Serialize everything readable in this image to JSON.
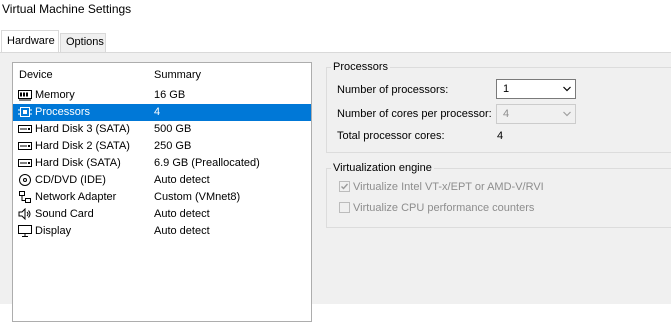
{
  "window": {
    "title": "Virtual Machine Settings"
  },
  "tabs": [
    {
      "label": "Hardware",
      "active": true
    },
    {
      "label": "Options",
      "active": false
    }
  ],
  "device_list": {
    "headers": {
      "device": "Device",
      "summary": "Summary"
    },
    "selected_index": 1,
    "items": [
      {
        "icon": "memory-icon",
        "device": "Memory",
        "summary": "16 GB"
      },
      {
        "icon": "processor-icon",
        "device": "Processors",
        "summary": "4"
      },
      {
        "icon": "hard-disk-icon",
        "device": "Hard Disk 3 (SATA)",
        "summary": "500 GB"
      },
      {
        "icon": "hard-disk-icon",
        "device": "Hard Disk 2 (SATA)",
        "summary": "250 GB"
      },
      {
        "icon": "hard-disk-icon",
        "device": "Hard Disk (SATA)",
        "summary": "6.9 GB (Preallocated)"
      },
      {
        "icon": "cd-dvd-icon",
        "device": "CD/DVD (IDE)",
        "summary": "Auto detect"
      },
      {
        "icon": "network-adapter-icon",
        "device": "Network Adapter",
        "summary": "Custom (VMnet8)"
      },
      {
        "icon": "sound-card-icon",
        "device": "Sound Card",
        "summary": "Auto detect"
      },
      {
        "icon": "display-icon",
        "device": "Display",
        "summary": "Auto detect"
      }
    ]
  },
  "processors": {
    "group_label": "Processors",
    "num_processors_label": "Number of processors:",
    "num_processors_value": "1",
    "cores_label": "Number of cores per processor:",
    "cores_value": "4",
    "total_label": "Total processor cores:",
    "total_value": "4"
  },
  "virtualization": {
    "group_label": "Virtualization engine",
    "vtx_label": "Virtualize Intel VT-x/EPT or AMD-V/RVI",
    "vtx_checked": true,
    "perf_label": "Virtualize CPU performance counters",
    "perf_checked": false
  },
  "colors": {
    "selection": "#0078d7",
    "panel": "#f0f0f0",
    "disabled_text": "#8d8d8d"
  }
}
